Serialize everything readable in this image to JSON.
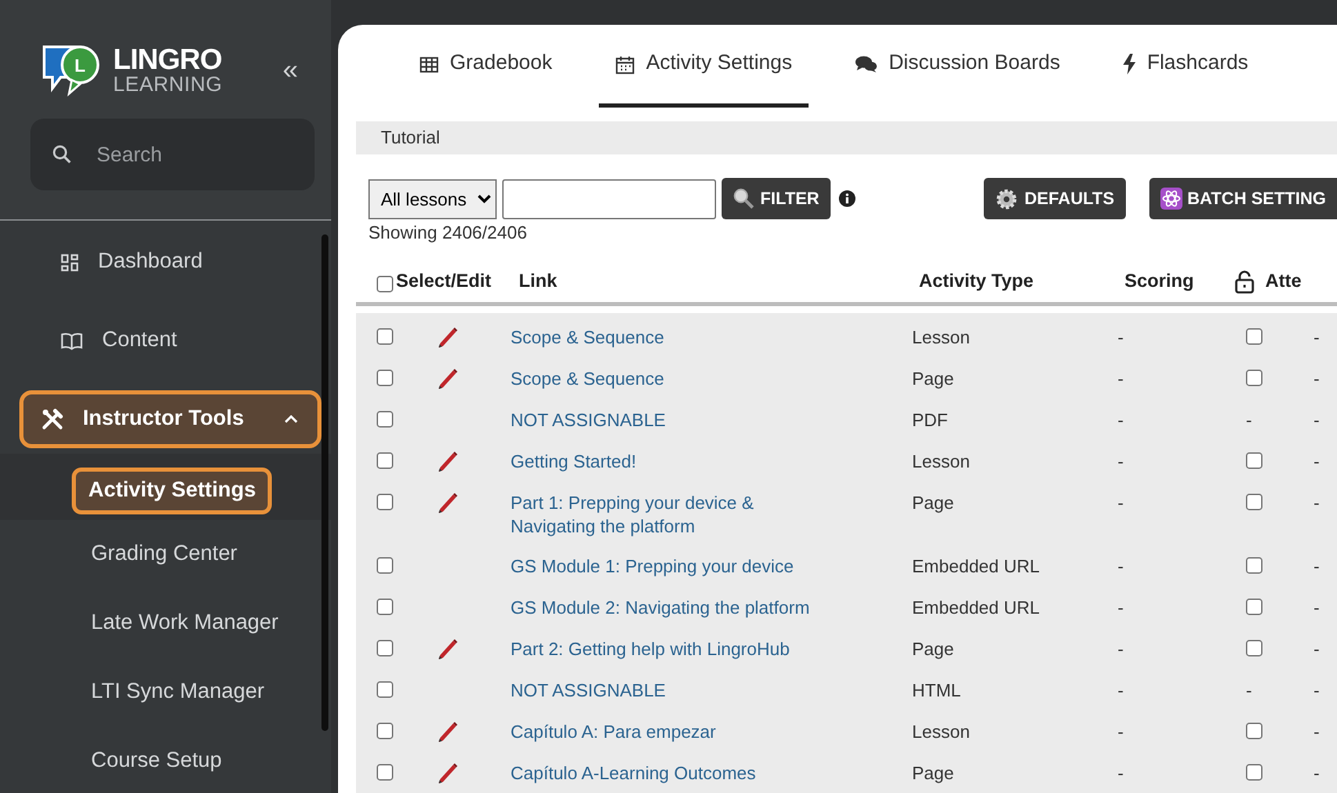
{
  "sidebar": {
    "logo": {
      "mark": "L",
      "name": "LINGRO",
      "subtitle": "LEARNING"
    },
    "collapse": "«",
    "search": {
      "placeholder": "Search"
    },
    "items": [
      {
        "label": "Dashboard",
        "highlighted": false
      },
      {
        "label": "Content",
        "highlighted": false
      },
      {
        "label": "Instructor Tools",
        "highlighted": true,
        "expanded": true,
        "children": [
          {
            "label": "Activity Settings",
            "highlighted": true
          },
          {
            "label": "Grading Center",
            "highlighted": false
          },
          {
            "label": "Late Work Manager",
            "highlighted": false
          },
          {
            "label": "LTI Sync Manager",
            "highlighted": false
          },
          {
            "label": "Course Setup",
            "highlighted": false
          }
        ]
      }
    ]
  },
  "tabs": [
    {
      "label": "Gradebook",
      "selected": false
    },
    {
      "label": "Activity Settings",
      "selected": true
    },
    {
      "label": "Discussion Boards",
      "selected": false
    },
    {
      "label": "Flashcards",
      "selected": false
    }
  ],
  "breadcrumb": "Tutorial",
  "filter": {
    "lesson_select": "All lessons",
    "filter_button": "FILTER",
    "showing": "Showing 2406/2406"
  },
  "buttons": [
    "DEFAULTS",
    "BATCH SETTING"
  ],
  "table": {
    "select_all_checked": false,
    "columns": [
      "Select/Edit",
      "Link",
      "Activity Type",
      "Scoring",
      "Atte"
    ],
    "rows": [
      {
        "checked": false,
        "editable": true,
        "link": "Scope & Sequence",
        "activity_type": "Lesson",
        "scoring": "-",
        "lock": {
          "kind": "checkbox",
          "checked": false
        },
        "column_6": "-"
      },
      {
        "checked": false,
        "editable": true,
        "link": "Scope & Sequence",
        "activity_type": "Page",
        "scoring": "-",
        "lock": {
          "kind": "checkbox",
          "checked": false
        },
        "column_6": "-"
      },
      {
        "checked": false,
        "editable": false,
        "link": "NOT ASSIGNABLE",
        "activity_type": "PDF",
        "scoring": "-",
        "lock": {
          "kind": "text",
          "text": "-"
        },
        "column_6": "-"
      },
      {
        "checked": false,
        "editable": true,
        "link": "Getting Started!",
        "activity_type": "Lesson",
        "scoring": "-",
        "lock": {
          "kind": "checkbox",
          "checked": false
        },
        "column_6": "-"
      },
      {
        "checked": false,
        "editable": true,
        "link": "Part 1: Prepping your device & Navigating the platform",
        "activity_type": "Page",
        "scoring": "-",
        "lock": {
          "kind": "checkbox",
          "checked": false
        },
        "column_6": "-"
      },
      {
        "checked": false,
        "editable": false,
        "link": "GS Module 1: Prepping your device",
        "activity_type": "Embedded URL",
        "scoring": "-",
        "lock": {
          "kind": "checkbox",
          "checked": false
        },
        "column_6": "-"
      },
      {
        "checked": false,
        "editable": false,
        "link": "GS Module 2: Navigating the platform",
        "activity_type": "Embedded URL",
        "scoring": "-",
        "lock": {
          "kind": "checkbox",
          "checked": false
        },
        "column_6": "-"
      },
      {
        "checked": false,
        "editable": true,
        "link": "Part 2: Getting help with LingroHub",
        "activity_type": "Page",
        "scoring": "-",
        "lock": {
          "kind": "checkbox",
          "checked": false
        },
        "column_6": "-"
      },
      {
        "checked": false,
        "editable": false,
        "link": "NOT ASSIGNABLE",
        "activity_type": "HTML",
        "scoring": "-",
        "lock": {
          "kind": "text",
          "text": "-"
        },
        "column_6": "-"
      },
      {
        "checked": false,
        "editable": true,
        "link": "Capítulo A: Para empezar",
        "activity_type": "Lesson",
        "scoring": "-",
        "lock": {
          "kind": "checkbox",
          "checked": false
        },
        "column_6": "-"
      },
      {
        "checked": false,
        "editable": true,
        "link": "Capítulo A-Learning Outcomes",
        "activity_type": "Page",
        "scoring": "-",
        "lock": {
          "kind": "checkbox",
          "checked": false
        },
        "column_6": "-"
      }
    ]
  }
}
